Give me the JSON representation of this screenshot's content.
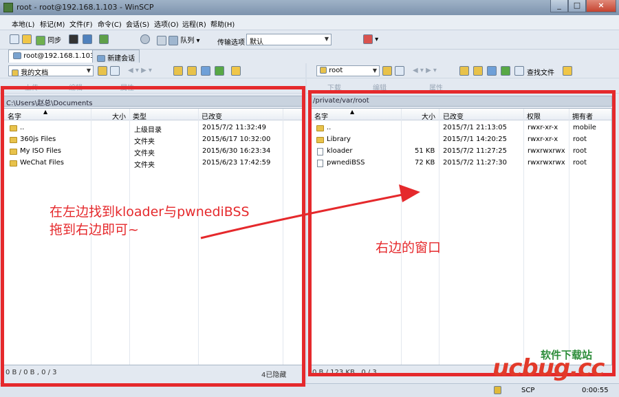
{
  "window": {
    "title": "root - root@192.168.1.103 - WinSCP",
    "min": "_",
    "max": "□",
    "close": "×"
  },
  "menu": [
    "本地(L)",
    "标记(M)",
    "文件(F)",
    "命令(C)",
    "会话(S)",
    "选项(O)",
    "远程(R)",
    "帮助(H)"
  ],
  "toolbar": {
    "sync": "同步",
    "queue": "队列",
    "transfer_label": "传输选项",
    "transfer_value": "默认"
  },
  "tabs": [
    {
      "label": "root@192.168.1.103"
    },
    {
      "label": "新建会话"
    }
  ],
  "left": {
    "location": "我的文档",
    "path": "C:\\Users\\赵总\\Documents",
    "toolbar2": [
      "上传",
      "编辑",
      "属性"
    ],
    "columns": {
      "name": "名字",
      "size": "大小",
      "type": "类型",
      "changed": "已改变"
    },
    "rows": [
      {
        "name": "..",
        "size": "",
        "type": "上级目录",
        "changed": "2015/7/2   11:32:49"
      },
      {
        "name": "360js Files",
        "size": "",
        "type": "文件夹",
        "changed": "2015/6/17  10:32:00"
      },
      {
        "name": "My ISO Files",
        "size": "",
        "type": "文件夹",
        "changed": "2015/6/30  16:23:34"
      },
      {
        "name": "WeChat Files",
        "size": "",
        "type": "文件夹",
        "changed": "2015/6/23  17:42:59"
      }
    ],
    "status": "0 B / 0 B , 0 / 3",
    "hidden": "4已隐藏"
  },
  "right": {
    "location": "root",
    "find": "查找文件",
    "path": "/private/var/root",
    "toolbar2": [
      "下载",
      "编辑",
      "属性"
    ],
    "columns": {
      "name": "名字",
      "size": "大小",
      "changed": "已改变",
      "rights": "权限",
      "owner": "拥有者"
    },
    "rows": [
      {
        "name": "..",
        "size": "",
        "changed": "2015/7/1 21:13:05",
        "rights": "rwxr-xr-x",
        "owner": "mobile"
      },
      {
        "name": "Library",
        "size": "",
        "changed": "2015/7/1 14:20:25",
        "rights": "rwxr-xr-x",
        "owner": "root"
      },
      {
        "name": "kloader",
        "size": "51 KB",
        "changed": "2015/7/2 11:27:25",
        "rights": "rwxrwxrwx",
        "owner": "root"
      },
      {
        "name": "pwnediBSS",
        "size": "72 KB",
        "changed": "2015/7/2 11:27:30",
        "rights": "rwxrwxrwx",
        "owner": "root"
      }
    ],
    "status": "0 B / 123 KB , 0 / 3"
  },
  "bottom": {
    "protocol": "SCP",
    "time": "0:00:55"
  },
  "annotations": {
    "left_line1": "在左边找到kloader与pwnediBSS",
    "left_line2": "拖到右边即可~",
    "right": "右边的窗口"
  },
  "watermark": {
    "top": "软件下载站",
    "main": "ucbug.cc"
  },
  "colors": {
    "annotation_red": "#e5292c"
  }
}
